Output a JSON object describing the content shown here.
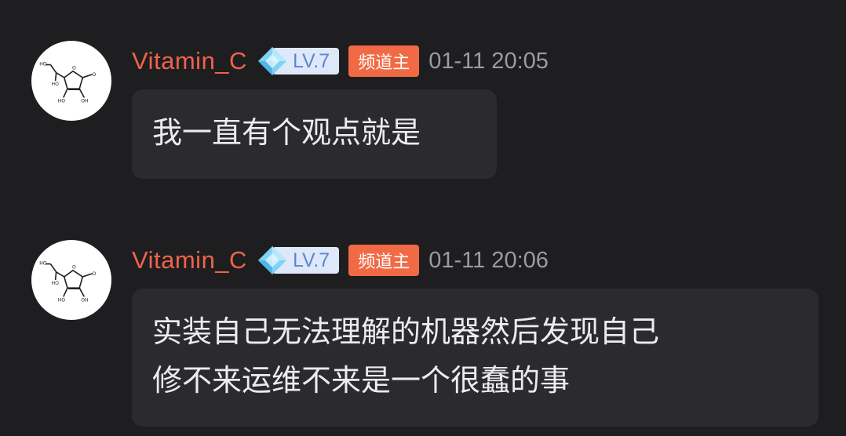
{
  "messages": [
    {
      "username": "Vitamin_C",
      "level": "LV.7",
      "role_badge": "频道主",
      "timestamp": "01-11 20:05",
      "lines": [
        "我一直有个观点就是"
      ]
    },
    {
      "username": "Vitamin_C",
      "level": "LV.7",
      "role_badge": "频道主",
      "timestamp": "01-11 20:06",
      "lines": [
        "实装自己无法理解的机器然后发现自己",
        "修不来运维不来是一个很蠢的事"
      ]
    }
  ],
  "icons": {
    "avatar": "vitamin-c-molecule-icon",
    "level": "diamond-gem-icon"
  },
  "colors": {
    "background": "#1e1e20",
    "bubble": "#2b2b2f",
    "username": "#f0624a",
    "role_badge": "#f26a45",
    "level_badge_bg": "#dfe8f8",
    "level_text": "#5b87d6",
    "timestamp": "#9b9ba2",
    "message_text": "#ececf0"
  }
}
